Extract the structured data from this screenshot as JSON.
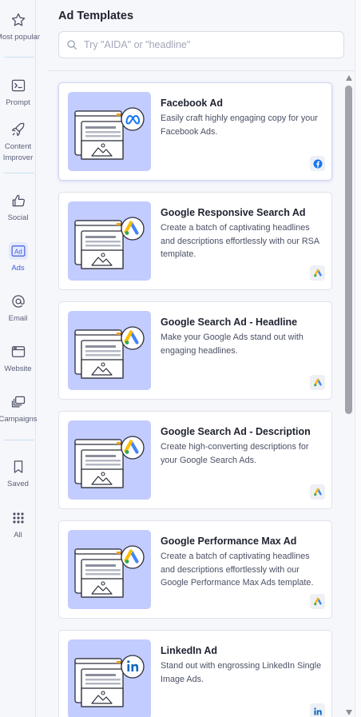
{
  "sidebar": {
    "items": [
      {
        "label": "Most popular"
      },
      {
        "label": "Prompt"
      },
      {
        "label": "Content\nImprover"
      },
      {
        "label": "Social"
      },
      {
        "label": "Ads"
      },
      {
        "label": "Email"
      },
      {
        "label": "Website"
      },
      {
        "label": "Campaigns"
      },
      {
        "label": "Saved"
      },
      {
        "label": "All"
      }
    ],
    "active_item": "Ads"
  },
  "header": {
    "title": "Ad Templates",
    "search_placeholder": "Try \"AIDA\" or \"headline\""
  },
  "templates": [
    {
      "title": "Facebook Ad",
      "description": "Easily craft highly engaging copy for your Facebook Ads.",
      "platform_icon": "meta-logo",
      "badge_icon": "facebook-icon"
    },
    {
      "title": "Google Responsive Search Ad",
      "description": "Create a batch of captivating headlines and descriptions effortlessly with our RSA template.",
      "platform_icon": "google-ads-logo",
      "badge_icon": "google-ads-icon"
    },
    {
      "title": "Google Search Ad - Headline",
      "description": "Make your Google Ads stand out with engaging headlines.",
      "platform_icon": "google-ads-logo",
      "badge_icon": "google-ads-icon"
    },
    {
      "title": "Google Search Ad - Description",
      "description": "Create high-converting descriptions for your Google Search Ads.",
      "platform_icon": "google-ads-logo",
      "badge_icon": "google-ads-icon"
    },
    {
      "title": "Google Performance Max Ad",
      "description": "Create a batch of captivating headlines and descriptions effortlessly with our Google Performance Max Ads template.",
      "platform_icon": "google-ads-logo",
      "badge_icon": "google-ads-icon"
    },
    {
      "title": "LinkedIn Ad",
      "description": "Stand out with engrossing LinkedIn Single Image Ads.",
      "platform_icon": "linkedin-logo",
      "badge_icon": "linkedin-icon"
    }
  ],
  "colors": {
    "accent": "#3d5bd9",
    "thumb_bg": "#c3ccff",
    "facebook": "#1877f2",
    "linkedin": "#0a66c2",
    "google_blue": "#4285f4",
    "google_yellow": "#fbbc04",
    "google_green": "#34a853"
  }
}
